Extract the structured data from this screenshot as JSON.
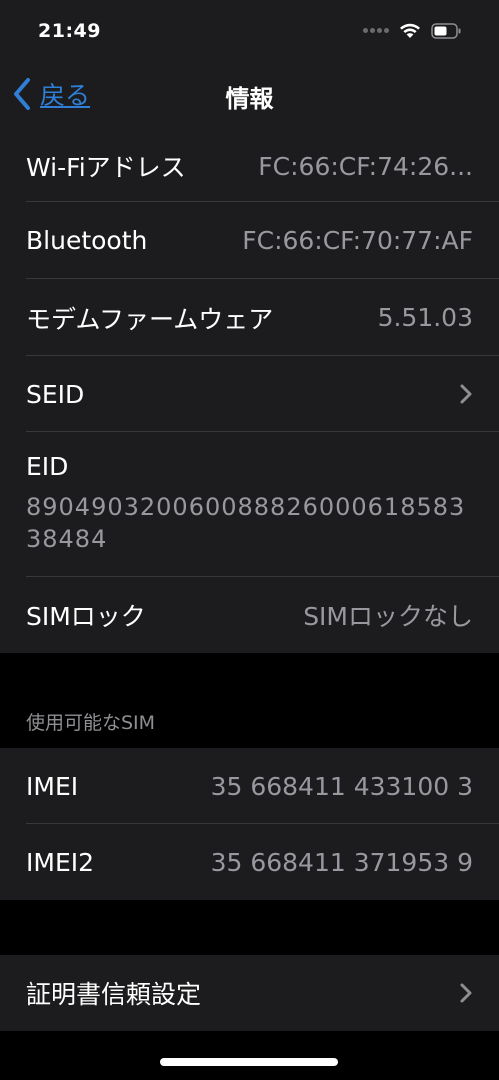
{
  "status_bar": {
    "time": "21:49"
  },
  "nav": {
    "back_label": "戻る",
    "title": "情報"
  },
  "info_rows": [
    {
      "label": "Wi-Fiアドレス",
      "value": "FC:66:CF:74:26..."
    },
    {
      "label": "Bluetooth",
      "value": "FC:66:CF:70:77:AF"
    },
    {
      "label": "モデムファームウェア",
      "value": "5.51.03"
    },
    {
      "label": "SEID"
    },
    {
      "label": "EID",
      "value": "89049032006008882600061858338484"
    },
    {
      "label": "SIMロック",
      "value": "SIMロックなし"
    }
  ],
  "sim_section": {
    "header": "使用可能なSIM",
    "rows": [
      {
        "label": "IMEI",
        "value": "35 668411 433100 3"
      },
      {
        "label": "IMEI2",
        "value": "35 668411 371953 9"
      }
    ]
  },
  "certificate": {
    "label": "証明書信頼設定"
  },
  "colors": {
    "background": "#000000",
    "cell": "#1c1c1e",
    "separator": "#38383a",
    "secondary_text": "#98989f",
    "accent": "#2f7fd6"
  }
}
